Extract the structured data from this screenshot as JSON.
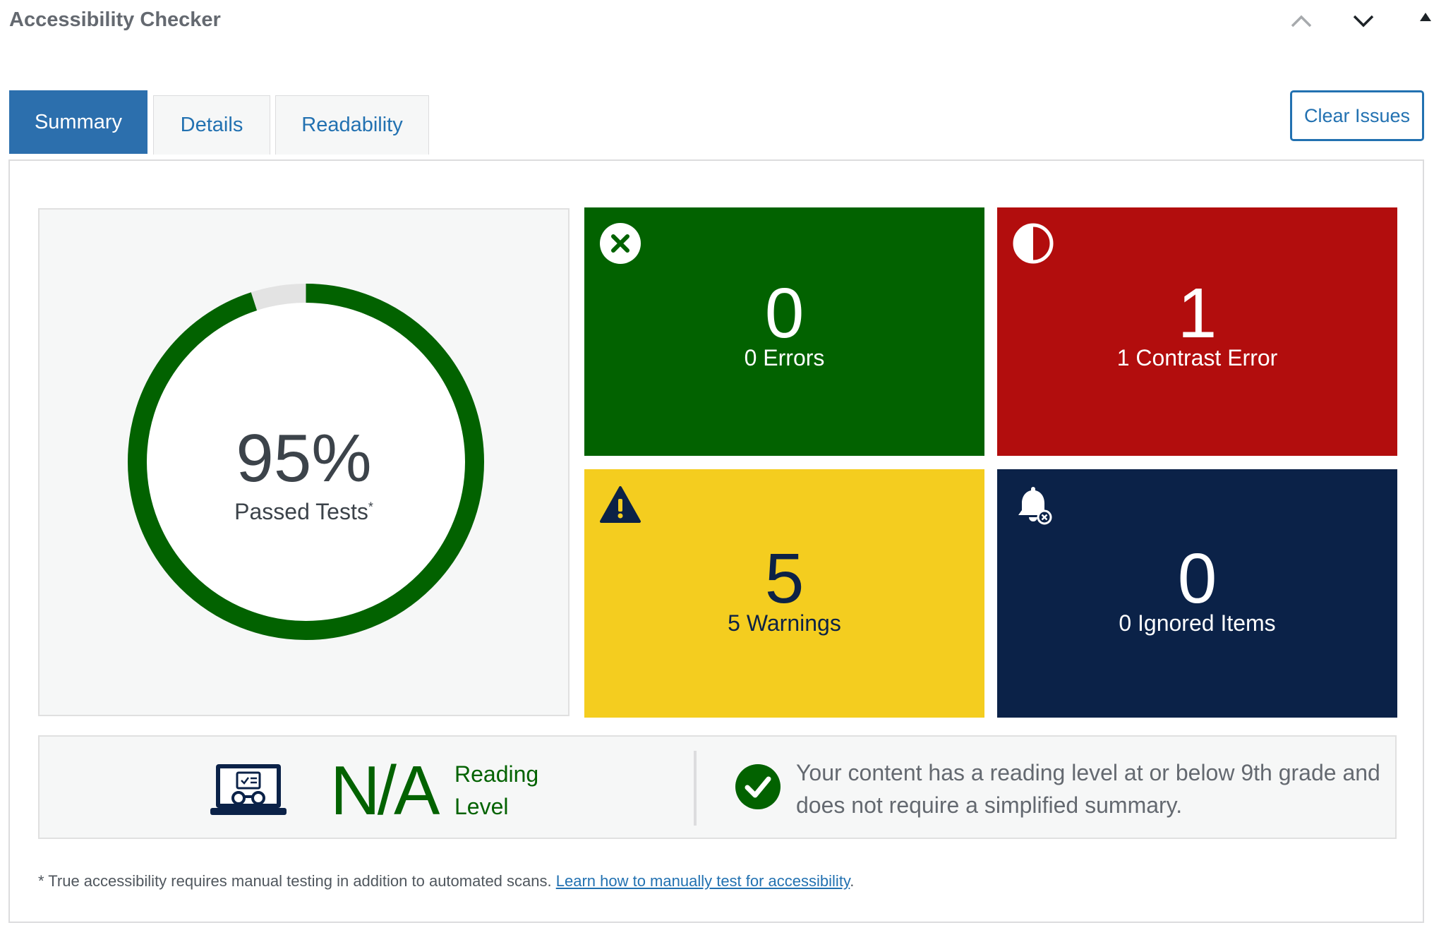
{
  "header": {
    "title": "Accessibility Checker",
    "icons": [
      "chevron-up-icon",
      "chevron-down-icon",
      "triangle-up-icon"
    ]
  },
  "tabs": [
    {
      "label": "Summary",
      "active": true
    },
    {
      "label": "Details",
      "active": false
    },
    {
      "label": "Readability",
      "active": false
    }
  ],
  "actions": {
    "clear_issues": "Clear Issues"
  },
  "summary": {
    "passed_percent": "95%",
    "passed_value": 95,
    "passed_label": "Passed Tests",
    "asterisk": "*"
  },
  "tiles": {
    "errors": {
      "count": "0",
      "label": "0 Errors",
      "icon": "x-circle-icon",
      "color": "#026200"
    },
    "contrast": {
      "count": "1",
      "label": "1 Contrast Error",
      "icon": "half-circle-contrast-icon",
      "color": "#b20d0d"
    },
    "warnings": {
      "count": "5",
      "label": "5 Warnings",
      "icon": "warning-triangle-icon",
      "color": "#f4cd1f"
    },
    "ignored": {
      "count": "0",
      "label": "0 Ignored Items",
      "icon": "bell-ignore-icon",
      "color": "#0b2248"
    }
  },
  "readability": {
    "value": "N/A",
    "label_line1": "Reading",
    "label_line2": "Level",
    "message": "Your content has a reading level at or below 9th grade and does not require a simplified summary."
  },
  "footnote": {
    "text": "* True accessibility requires manual testing in addition to automated scans. ",
    "link_text": "Learn how to manually test for accessibility",
    "period": "."
  },
  "colors": {
    "accent": "#2c6fad",
    "link": "#2271b1",
    "success": "#026200",
    "gauge_track": "#e3e3e3"
  }
}
